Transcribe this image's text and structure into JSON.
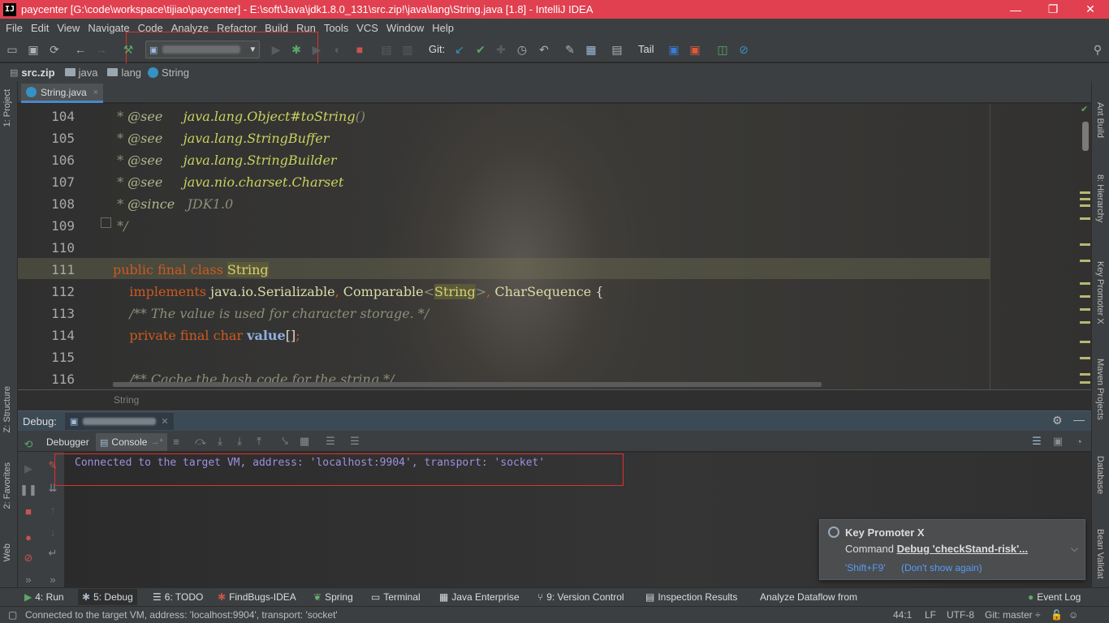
{
  "window": {
    "title": "paycenter [G:\\code\\workspace\\tijiao\\paycenter] - E:\\soft\\Java\\jdk1.8.0_131\\src.zip!\\java\\lang\\String.java [1.8] - IntelliJ IDEA",
    "app_icon_text": "IJ"
  },
  "menu": [
    "File",
    "Edit",
    "View",
    "Navigate",
    "Code",
    "Analyze",
    "Refactor",
    "Build",
    "Run",
    "Tools",
    "VCS",
    "Window",
    "Help"
  ],
  "toolbar": {
    "git_label": "Git:",
    "tail_label": "Tail"
  },
  "breadcrumb": [
    "src.zip",
    "java",
    "lang",
    "String"
  ],
  "editor_tab": {
    "label": "String.java",
    "close": "×"
  },
  "editor": {
    "line_numbers": [
      "104",
      "105",
      "106",
      "107",
      "108",
      "109",
      "110",
      "111",
      "112",
      "113",
      "114",
      "115",
      "116"
    ],
    "code_breadcrumb": "String"
  },
  "left_strip": [
    "1: Project",
    "Z: Structure",
    "2: Favorites",
    "Web"
  ],
  "right_strip": [
    "Ant Build",
    "8: Hierarchy",
    "Key Promoter X",
    "Maven Projects",
    "Database",
    "Bean Validat"
  ],
  "debug": {
    "label": "Debug:",
    "tabs": {
      "debugger": "Debugger",
      "console": "Console"
    },
    "console_line": "Connected to the target VM, address: 'localhost:9904', transport: 'socket'"
  },
  "notification": {
    "title": "Key Promoter X",
    "message_prefix": "Command ",
    "message_action": "Debug 'checkStand-risk'...",
    "shortcut": "'Shift+F9'",
    "dont_show": "(Don't show again)"
  },
  "tool_windows": {
    "run": "4: Run",
    "debug": "5: Debug",
    "todo": "6: TODO",
    "findbugs": "FindBugs-IDEA",
    "spring": "Spring",
    "terminal": "Terminal",
    "java_enterprise": "Java Enterprise",
    "version_control": "9: Version Control",
    "inspection": "Inspection Results",
    "dataflow": "Analyze Dataflow from",
    "event_log": "Event Log"
  },
  "status": {
    "message": "Connected to the target VM, address: 'localhost:9904', transport: 'socket'",
    "position": "44:1",
    "line_sep": "LF",
    "encoding": "UTF-8",
    "git_branch": "Git: master ÷"
  },
  "colors": {
    "title_bar": "#e04050",
    "chrome": "#3c3f41",
    "keyword": "#cc5a1e",
    "console_text": "#9e8fe0",
    "link": "#589df6"
  }
}
